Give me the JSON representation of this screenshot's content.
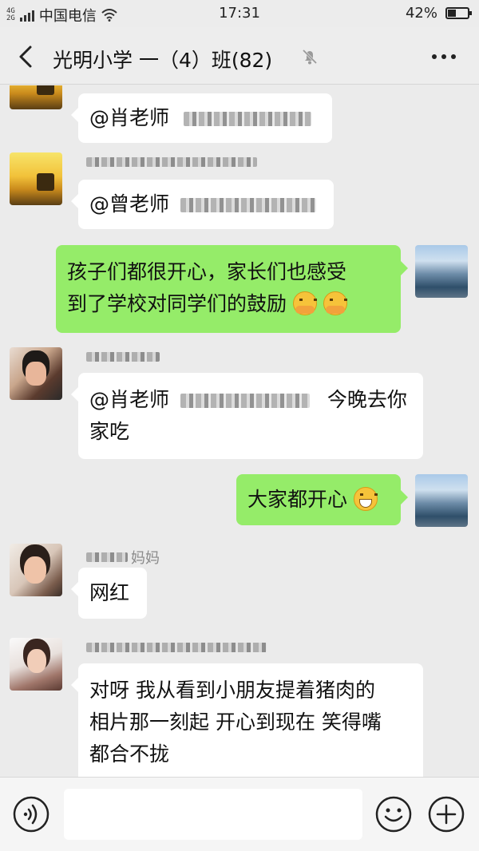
{
  "status_bar": {
    "network_tag": "4G",
    "network_tag2": "2G",
    "carrier": "中国电信",
    "time": "17:31",
    "battery_percent": "42%",
    "battery_level": 0.42
  },
  "header": {
    "title": "光明小学 一（4）班(82)",
    "icons": {
      "back": "chevron-left-icon",
      "mute": "bell-muted-icon",
      "more": "more-dots-icon"
    }
  },
  "messages": [
    {
      "id": "m1",
      "direction": "incoming",
      "avatar": "sunset-avatar",
      "sender_blurred": true,
      "text": "@肖老师",
      "text_blurred_tail": true
    },
    {
      "id": "m2",
      "direction": "incoming",
      "avatar": "sunset-avatar",
      "sender_blurred": true,
      "text": "@曾老师",
      "text_blurred_tail": true
    },
    {
      "id": "m3",
      "direction": "outgoing",
      "avatar": "sea-avatar",
      "lines": [
        "孩子们都很开心，家长们也感受",
        "到了学校对同学们的鼓励"
      ],
      "emoji": [
        "hug-emoji",
        "hug-emoji"
      ]
    },
    {
      "id": "m4",
      "direction": "incoming",
      "avatar": "photo-avatar",
      "sender_blurred": true,
      "lines": [
        "@肖老师",
        "今晚去你",
        "家吃"
      ]
    },
    {
      "id": "m5",
      "direction": "outgoing",
      "avatar": "sea-avatar",
      "text": "大家都开心",
      "emoji": [
        "grin-emoji"
      ]
    },
    {
      "id": "m6",
      "direction": "incoming",
      "avatar": "photo-avatar",
      "sender": "妈妈",
      "sender_prefix_blurred": true,
      "text": "网红"
    },
    {
      "id": "m7",
      "direction": "incoming",
      "avatar": "photo-avatar",
      "sender_blurred": true,
      "lines": [
        "对呀 我从看到小朋友提着猪肉的",
        "相片那一刻起 开心到现在 笑得嘴",
        "都合不拢"
      ]
    }
  ],
  "input_bar": {
    "text_value": "",
    "icons": {
      "voice": "voice-icon",
      "emoji": "emoji-icon",
      "plus": "plus-icon"
    }
  },
  "colors": {
    "background": "#ebebeb",
    "outgoing_bubble": "#95ec69",
    "incoming_bubble": "#ffffff"
  }
}
